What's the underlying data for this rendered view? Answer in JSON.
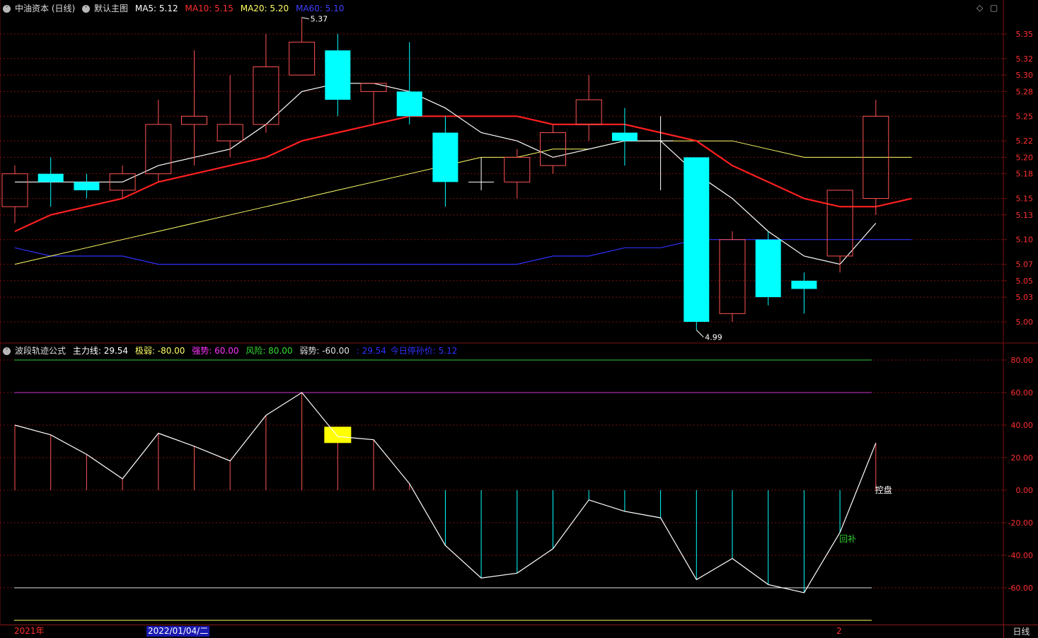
{
  "main_header": {
    "title": "中油资本 (日线)",
    "template": "默认主图",
    "ma5": "MA5: 5.12",
    "ma10": "MA10: 5.15",
    "ma20": "MA20: 5.20",
    "ma60": "MA60: 5.10"
  },
  "sub_header": {
    "title": "波段轨迹公式",
    "main_line": "主力线: 29.54",
    "ji_ruo": "极弱: -80.00",
    "qiang_shi": "强势: 60.00",
    "feng_xian": "风险: 80.00",
    "ruo_shi": "弱势: -60.00",
    "extra_value": ": 29.54",
    "today_price": "今日停孙价: 5.12"
  },
  "controls": {
    "diamond": "◇",
    "window": "▢"
  },
  "date_axis": {
    "year": "2021年",
    "selected_date": "2022/01/04/二",
    "mark": "2"
  },
  "period_label": "日线",
  "colors": {
    "background": "#000000",
    "up": "#ff5252",
    "down": "#00ffff",
    "ma5": "#ffffff",
    "ma10": "#ff1f1f",
    "ma20": "#ffff66",
    "ma60": "#3030ff",
    "grid": "#7a1010",
    "axis_text": "#ff3030"
  },
  "chart_data": [
    {
      "type": "candlestick",
      "title": "中油资本 (日线)",
      "ylim": [
        4.97,
        5.38
      ],
      "y_ticks": [
        5.0,
        5.03,
        5.05,
        5.07,
        5.1,
        5.13,
        5.15,
        5.18,
        5.2,
        5.22,
        5.25,
        5.28,
        5.3,
        5.32,
        5.35
      ],
      "candles": [
        {
          "o": 5.14,
          "h": 5.19,
          "l": 5.12,
          "c": 5.18
        },
        {
          "o": 5.18,
          "h": 5.2,
          "l": 5.14,
          "c": 5.17
        },
        {
          "o": 5.17,
          "h": 5.18,
          "l": 5.15,
          "c": 5.16
        },
        {
          "o": 5.16,
          "h": 5.19,
          "l": 5.15,
          "c": 5.18
        },
        {
          "o": 5.18,
          "h": 5.27,
          "l": 5.17,
          "c": 5.24
        },
        {
          "o": 5.24,
          "h": 5.33,
          "l": 5.19,
          "c": 5.25
        },
        {
          "o": 5.22,
          "h": 5.3,
          "l": 5.2,
          "c": 5.24
        },
        {
          "o": 5.24,
          "h": 5.35,
          "l": 5.23,
          "c": 5.31
        },
        {
          "o": 5.3,
          "h": 5.37,
          "l": 5.3,
          "c": 5.34
        },
        {
          "o": 5.33,
          "h": 5.35,
          "l": 5.25,
          "c": 5.27
        },
        {
          "o": 5.28,
          "h": 5.29,
          "l": 5.24,
          "c": 5.29
        },
        {
          "o": 5.28,
          "h": 5.34,
          "l": 5.24,
          "c": 5.25
        },
        {
          "o": 5.23,
          "h": 5.25,
          "l": 5.14,
          "c": 5.17
        },
        {
          "o": 5.17,
          "h": 5.2,
          "l": 5.16,
          "c": 5.17
        },
        {
          "o": 5.17,
          "h": 5.21,
          "l": 5.15,
          "c": 5.2
        },
        {
          "o": 5.19,
          "h": 5.24,
          "l": 5.18,
          "c": 5.23
        },
        {
          "o": 5.24,
          "h": 5.3,
          "l": 5.22,
          "c": 5.27
        },
        {
          "o": 5.23,
          "h": 5.26,
          "l": 5.19,
          "c": 5.22
        },
        {
          "o": 5.22,
          "h": 5.25,
          "l": 5.16,
          "c": 5.22
        },
        {
          "o": 5.2,
          "h": 5.2,
          "l": 4.99,
          "c": 5.0
        },
        {
          "o": 5.01,
          "h": 5.11,
          "l": 5.0,
          "c": 5.1
        },
        {
          "o": 5.1,
          "h": 5.11,
          "l": 5.02,
          "c": 5.03
        },
        {
          "o": 5.05,
          "h": 5.06,
          "l": 5.01,
          "c": 5.04
        },
        {
          "o": 5.08,
          "h": 5.16,
          "l": 5.06,
          "c": 5.16
        },
        {
          "o": 5.15,
          "h": 5.27,
          "l": 5.13,
          "c": 5.25
        }
      ],
      "ma5": [
        5.17,
        5.17,
        5.17,
        5.17,
        5.19,
        5.2,
        5.21,
        5.24,
        5.28,
        5.29,
        5.29,
        5.28,
        5.26,
        5.23,
        5.22,
        5.2,
        5.21,
        5.22,
        5.22,
        5.18,
        5.15,
        5.11,
        5.08,
        5.07,
        5.12
      ],
      "ma10": [
        5.11,
        5.13,
        5.14,
        5.15,
        5.17,
        5.18,
        5.19,
        5.2,
        5.22,
        5.23,
        5.24,
        5.25,
        5.25,
        5.25,
        5.25,
        5.24,
        5.24,
        5.24,
        5.23,
        5.22,
        5.19,
        5.17,
        5.15,
        5.14,
        5.14,
        5.15
      ],
      "ma20": [
        5.07,
        5.08,
        5.09,
        5.1,
        5.11,
        5.12,
        5.13,
        5.14,
        5.15,
        5.16,
        5.17,
        5.18,
        5.19,
        5.2,
        5.2,
        5.21,
        5.21,
        5.22,
        5.22,
        5.22,
        5.22,
        5.21,
        5.2,
        5.2,
        5.2,
        5.2
      ],
      "ma60": [
        5.09,
        5.08,
        5.08,
        5.08,
        5.07,
        5.07,
        5.07,
        5.07,
        5.07,
        5.07,
        5.07,
        5.07,
        5.07,
        5.07,
        5.07,
        5.08,
        5.08,
        5.09,
        5.09,
        5.1,
        5.1,
        5.1,
        5.1,
        5.1,
        5.1,
        5.1
      ],
      "annotations": [
        {
          "candle": 8,
          "price": 5.37,
          "text": "5.37"
        },
        {
          "candle": 19,
          "price": 4.99,
          "text": "4.99"
        }
      ]
    },
    {
      "type": "line",
      "title": "波段轨迹公式",
      "ylim": [
        -90,
        90
      ],
      "y_ticks": [
        80,
        60,
        40,
        20,
        0,
        -20,
        -40,
        -60
      ],
      "reference_lines": [
        {
          "value": 80,
          "color": "#33cc33"
        },
        {
          "value": 60,
          "color": "#cc33cc"
        },
        {
          "value": -60,
          "color": "#e0e0e0"
        },
        {
          "value": -80,
          "color": "#ffff66"
        }
      ],
      "values": [
        40,
        34,
        22,
        7,
        35,
        27,
        18,
        46,
        60,
        33,
        31,
        4,
        -34,
        -54,
        -51,
        -36,
        -6,
        -13,
        -17,
        -55,
        -42,
        -58,
        -63,
        -26,
        29
      ],
      "highlight_block": {
        "index": 9,
        "from": 29,
        "to": 39,
        "color": "#ffff00"
      },
      "labels": [
        {
          "index": 23,
          "value": -30,
          "text": "回补",
          "color": "#33cc33"
        },
        {
          "index": 24,
          "value": 0,
          "text": "控盘",
          "color": "#ffffff"
        }
      ]
    }
  ]
}
